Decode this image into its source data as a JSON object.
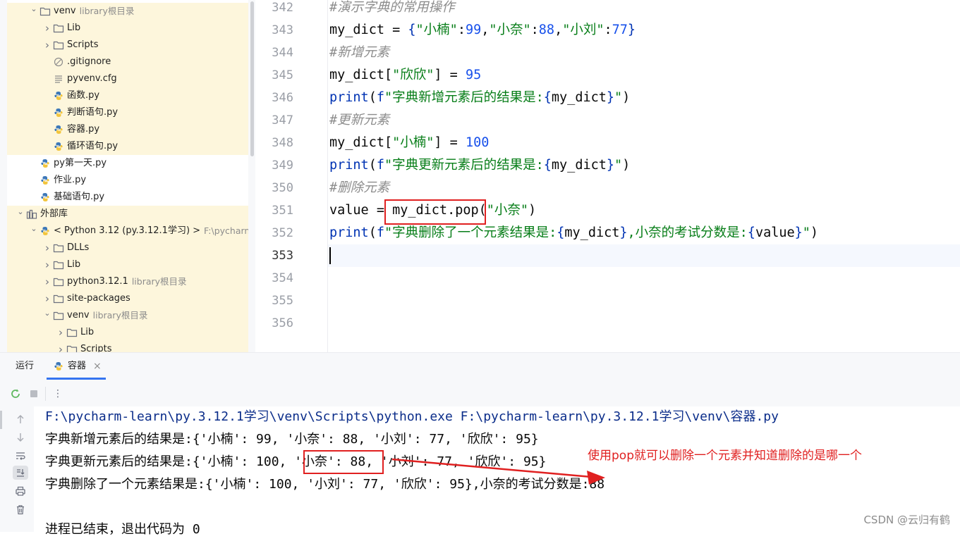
{
  "project_tree": [
    {
      "label": "venv",
      "muted": "library根目录",
      "type": "folder",
      "expanded": true,
      "indent": 1,
      "highlight": true
    },
    {
      "label": "Lib",
      "type": "folder",
      "expanded": false,
      "indent": 2,
      "highlight": true
    },
    {
      "label": "Scripts",
      "type": "folder",
      "expanded": false,
      "indent": 2,
      "highlight": true
    },
    {
      "label": ".gitignore",
      "type": "ignore",
      "indent": 2,
      "highlight": true
    },
    {
      "label": "pyvenv.cfg",
      "type": "text",
      "indent": 2,
      "highlight": true
    },
    {
      "label": "函数.py",
      "type": "python",
      "indent": 2,
      "highlight": true
    },
    {
      "label": "判断语句.py",
      "type": "python",
      "indent": 2,
      "highlight": true
    },
    {
      "label": "容器.py",
      "type": "python",
      "indent": 2,
      "highlight": true
    },
    {
      "label": "循环语句.py",
      "type": "python",
      "indent": 2,
      "highlight": true
    },
    {
      "label": "py第一天.py",
      "type": "python",
      "indent": 1,
      "highlight": false
    },
    {
      "label": "作业.py",
      "type": "python",
      "indent": 1,
      "highlight": false
    },
    {
      "label": "基础语句.py",
      "type": "python",
      "indent": 1,
      "highlight": false
    },
    {
      "label": "外部库",
      "type": "library",
      "expanded": true,
      "indent": 0,
      "highlight": true
    },
    {
      "label": "< Python 3.12 (py.3.12.1学习) >",
      "muted": "F:\\pycharm-l",
      "type": "python-sdk",
      "expanded": true,
      "indent": 1,
      "highlight": true
    },
    {
      "label": "DLLs",
      "type": "folder",
      "expanded": false,
      "indent": 2,
      "highlight": true
    },
    {
      "label": "Lib",
      "type": "folder",
      "expanded": false,
      "indent": 2,
      "highlight": true
    },
    {
      "label": "python3.12.1",
      "muted": "library根目录",
      "type": "folder",
      "expanded": false,
      "indent": 2,
      "highlight": true
    },
    {
      "label": "site-packages",
      "type": "folder",
      "expanded": false,
      "indent": 2,
      "highlight": true
    },
    {
      "label": "venv",
      "muted": "library根目录",
      "type": "folder",
      "expanded": true,
      "indent": 2,
      "highlight": true
    },
    {
      "label": "Lib",
      "type": "folder",
      "expanded": false,
      "indent": 3,
      "highlight": true
    },
    {
      "label": "Scripts",
      "type": "folder",
      "expanded": false,
      "indent": 3,
      "highlight": true
    }
  ],
  "editor": {
    "current_line": "353",
    "lines": [
      {
        "n": "342",
        "tokens": [
          {
            "c": "cmt",
            "t": "#演示字典的常用操作"
          }
        ]
      },
      {
        "n": "343",
        "tokens": [
          {
            "c": "",
            "t": "my_dict = "
          },
          {
            "c": "br",
            "t": "{"
          },
          {
            "c": "str",
            "t": "\"小楠\""
          },
          {
            "c": "",
            "t": ":"
          },
          {
            "c": "num",
            "t": "99"
          },
          {
            "c": "",
            "t": ","
          },
          {
            "c": "str",
            "t": "\"小奈\""
          },
          {
            "c": "",
            "t": ":"
          },
          {
            "c": "num",
            "t": "88"
          },
          {
            "c": "",
            "t": ","
          },
          {
            "c": "str",
            "t": "\"小刘\""
          },
          {
            "c": "",
            "t": ":"
          },
          {
            "c": "num",
            "t": "77"
          },
          {
            "c": "br",
            "t": "}"
          }
        ]
      },
      {
        "n": "344",
        "tokens": [
          {
            "c": "cmt",
            "t": "#新增元素"
          }
        ]
      },
      {
        "n": "345",
        "tokens": [
          {
            "c": "",
            "t": "my_dict["
          },
          {
            "c": "str",
            "t": "\"欣欣\""
          },
          {
            "c": "",
            "t": "] = "
          },
          {
            "c": "num",
            "t": "95"
          }
        ]
      },
      {
        "n": "346",
        "tokens": [
          {
            "c": "kw",
            "t": "print"
          },
          {
            "c": "",
            "t": "("
          },
          {
            "c": "kw",
            "t": "f"
          },
          {
            "c": "str",
            "t": "\"字典新增元素后的结果是:"
          },
          {
            "c": "br",
            "t": "{"
          },
          {
            "c": "",
            "t": "my_dict"
          },
          {
            "c": "br",
            "t": "}"
          },
          {
            "c": "str",
            "t": "\""
          },
          {
            "c": "",
            "t": ")"
          }
        ]
      },
      {
        "n": "347",
        "tokens": [
          {
            "c": "cmt",
            "t": "#更新元素"
          }
        ]
      },
      {
        "n": "348",
        "tokens": [
          {
            "c": "",
            "t": "my_dict["
          },
          {
            "c": "str",
            "t": "\"小楠\""
          },
          {
            "c": "",
            "t": "] = "
          },
          {
            "c": "num",
            "t": "100"
          }
        ]
      },
      {
        "n": "349",
        "tokens": [
          {
            "c": "kw",
            "t": "print"
          },
          {
            "c": "",
            "t": "("
          },
          {
            "c": "kw",
            "t": "f"
          },
          {
            "c": "str",
            "t": "\"字典更新元素后的结果是:"
          },
          {
            "c": "br",
            "t": "{"
          },
          {
            "c": "",
            "t": "my_dict"
          },
          {
            "c": "br",
            "t": "}"
          },
          {
            "c": "str",
            "t": "\""
          },
          {
            "c": "",
            "t": ")"
          }
        ]
      },
      {
        "n": "350",
        "tokens": [
          {
            "c": "cmt",
            "t": "#删除元素"
          }
        ]
      },
      {
        "n": "351",
        "tokens": [
          {
            "c": "",
            "t": "value = my_dict.pop("
          },
          {
            "c": "str",
            "t": "\"小奈\""
          },
          {
            "c": "",
            "t": ")"
          }
        ]
      },
      {
        "n": "352",
        "tokens": [
          {
            "c": "kw",
            "t": "print"
          },
          {
            "c": "",
            "t": "("
          },
          {
            "c": "kw",
            "t": "f"
          },
          {
            "c": "str",
            "t": "\"字典删除了一个元素结果是:"
          },
          {
            "c": "br",
            "t": "{"
          },
          {
            "c": "",
            "t": "my_dict"
          },
          {
            "c": "br",
            "t": "}"
          },
          {
            "c": "str",
            "t": ",小奈的考试分数是:"
          },
          {
            "c": "br",
            "t": "{"
          },
          {
            "c": "",
            "t": "value"
          },
          {
            "c": "br",
            "t": "}"
          },
          {
            "c": "str",
            "t": "\""
          },
          {
            "c": "",
            "t": ")"
          }
        ]
      },
      {
        "n": "353",
        "tokens": []
      },
      {
        "n": "354",
        "tokens": []
      },
      {
        "n": "355",
        "tokens": []
      },
      {
        "n": "356",
        "tokens": []
      }
    ]
  },
  "run_panel": {
    "tab_run": "运行",
    "tab_file": "容器",
    "tab_close": "×",
    "more": "⋮"
  },
  "console": {
    "lines": [
      "F:\\pycharm-learn\\py.3.12.1学习\\venv\\Scripts\\python.exe F:\\pycharm-learn\\py.3.12.1学习\\venv\\容器.py",
      "字典新增元素后的结果是:{'小楠': 99, '小奈': 88, '小刘': 77, '欣欣': 95}",
      "字典更新元素后的结果是:{'小楠': 100, '小奈': 88, '小刘': 77, '欣欣': 95}",
      "字典删除了一个元素结果是:{'小楠': 100, '小刘': 77, '欣欣': 95},小奈的考试分数是:88",
      "",
      "进程已结束，退出代码为 0"
    ]
  },
  "annotation": "使用pop就可以删除一个元素并知道删除的是哪一个",
  "watermark": "CSDN @云归有鹤",
  "colors": {
    "annotation": "#e02020",
    "keyword": "#0033b3",
    "string": "#067d17",
    "number": "#1750eb",
    "comment": "#8c8c8c"
  }
}
